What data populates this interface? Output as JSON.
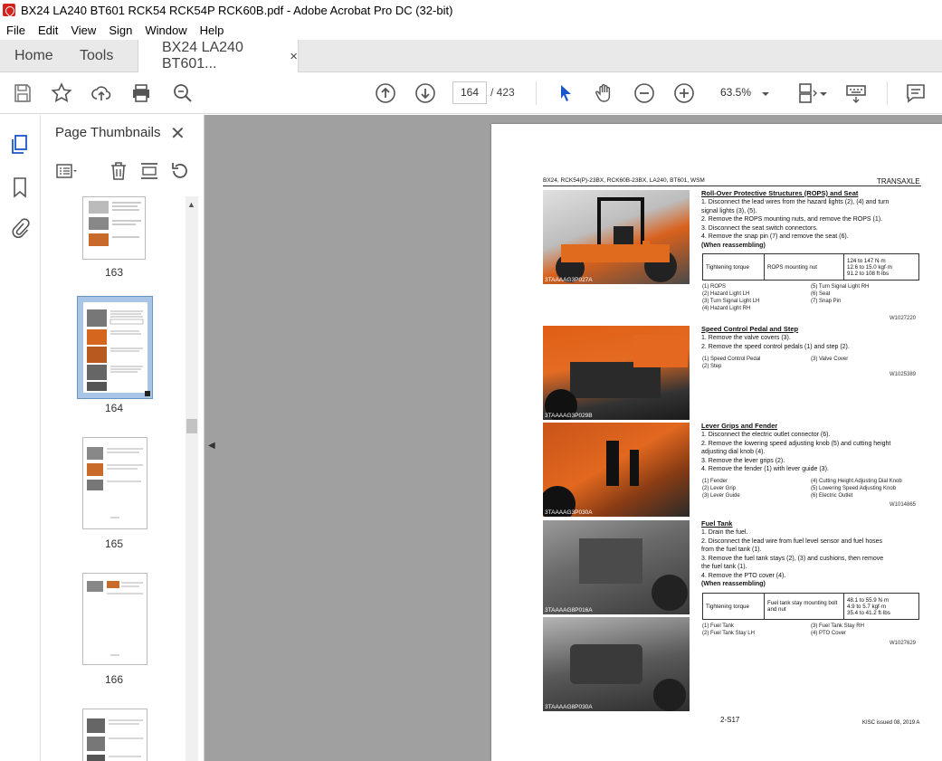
{
  "window": {
    "title": "BX24 LA240 BT601 RCK54 RCK54P RCK60B.pdf - Adobe Acrobat Pro DC (32-bit)"
  },
  "menu": [
    "File",
    "Edit",
    "View",
    "Sign",
    "Window",
    "Help"
  ],
  "tabs": {
    "home": "Home",
    "tools": "Tools",
    "doc": "BX24 LA240 BT601...",
    "doc_close": "×"
  },
  "toolbar": {
    "page_current": "164",
    "page_total": "/ 423",
    "zoom": "63.5%"
  },
  "thumbnails": {
    "title": "Page Thumbnails",
    "close": "✕",
    "pages": [
      {
        "label": "163"
      },
      {
        "label": "164",
        "selected": true
      },
      {
        "label": "165"
      },
      {
        "label": "166"
      },
      {
        "label": ""
      }
    ]
  },
  "pdf": {
    "header_left": "BX24, RCK54(P)-23BX, RCK60B-23BX, LA240, BT601, WSM",
    "header_right": "TRANSAXLE",
    "sections": [
      {
        "title": "Roll-Over Protective Structures (ROPS) and Seat",
        "steps": [
          "1.  Disconnect the lead wires from the hazard lights (2), (4) and turn",
          "     signal lights (3), (5).",
          "2.  Remove the ROPS mounting nuts, and remove the ROPS (1).",
          "3.  Disconnect the seat switch connectors.",
          "4.  Remove the snap pin (7) and remove the seat (6)."
        ],
        "reassembling": "(When reassembling)",
        "torque_label": "Tightening torque",
        "torque_item": "ROPS mounting nut",
        "torque_values": [
          "124 to 147 N·m",
          "12.6 to 15.0 kgf·m",
          "91.2 to 108 ft·lbs"
        ],
        "legend_left": [
          "(1)  ROPS",
          "(2)  Hazard Light LH",
          "(3)  Turn Signal Light LH",
          "(4)  Hazard Light RH"
        ],
        "legend_right": [
          "(5)  Turn Signal Light RH",
          "(6)  Seat",
          "(7)  Snap Pin"
        ],
        "ref": "W1027220",
        "photo_caption": "3TAAAAG3P027A"
      },
      {
        "title": "Speed Control Pedal and Step",
        "steps": [
          "1.  Remove the valve covers (3).",
          "2.  Remove the speed control pedals (1) and step (2)."
        ],
        "legend_left": [
          "(1)  Speed Control Pedal",
          "(2)  Step"
        ],
        "legend_right": [
          "(3)  Valve Cover"
        ],
        "ref": "W1025389",
        "photo_caption": "3TAAAAG3P029B"
      },
      {
        "title": "Lever Grips and Fender",
        "steps": [
          "1.  Disconnect the electric outlet connector (6).",
          "2.  Remove the lowering speed adjusting knob (5) and cutting height",
          "     adjusting dial knob (4).",
          "3.  Remove the lever grips (2).",
          "4.  Remove the fender (1) with lever guide (3)."
        ],
        "legend_left": [
          "(1)  Fender",
          "(2)  Lever Grip",
          "(3)  Lever Guide"
        ],
        "legend_right": [
          "(4)  Cutting Height Adjusting Dial Knob",
          "(5)  Lowering Speed Adjusting Knob",
          "(6)  Electric Outlet"
        ],
        "ref": "W1014865",
        "photo_caption": "3TAAAAG3P030A"
      },
      {
        "title": "Fuel Tank",
        "steps": [
          "1.  Drain the fuel.",
          "2.  Disconnect the lead wire from fuel level sensor and fuel hoses",
          "     from the fuel tank (1).",
          "3.  Remove the fuel tank stays (2), (3) and cushions, then remove",
          "     the fuel tank (1).",
          "4.  Remove the PTO cover (4)."
        ],
        "reassembling": "(When reassembling)",
        "torque_label": "Tightening torque",
        "torque_item": "Fuel tank stay mounting bolt and nut",
        "torque_values": [
          "48.1 to 55.9 N·m",
          "4.9 to 5.7 kgf·m",
          "35.4 to 41.2 ft·lbs"
        ],
        "legend_left": [
          "(1)  Fuel Tank",
          "(2)  Fuel Tank Stay LH"
        ],
        "legend_right": [
          "(3)  Fuel Tank Stay RH",
          "(4)  PTO Cover"
        ],
        "ref": "W1027629",
        "photo_caption": "3TAAAAG8P016A",
        "photo_caption_2": "3TAAAAG8P030A"
      }
    ],
    "page_number": "2-S17",
    "footer_right": "KISC issued 08, 2019 A"
  }
}
